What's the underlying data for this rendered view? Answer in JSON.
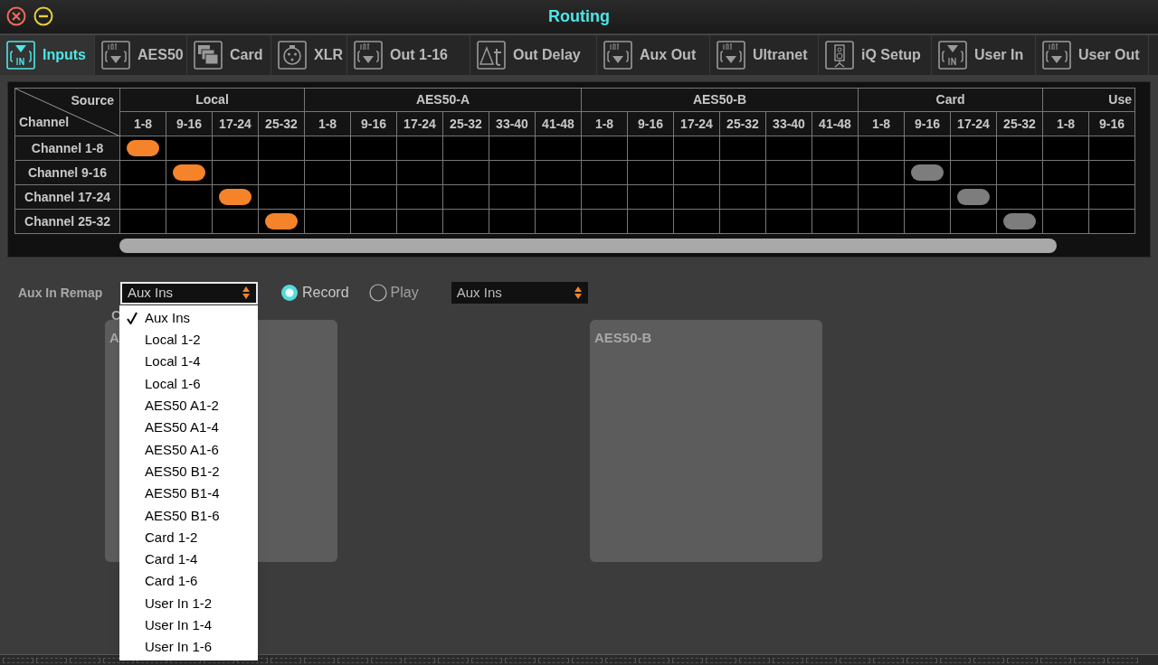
{
  "window": {
    "title": "Routing"
  },
  "tabs": [
    {
      "label": "Inputs",
      "selected": true
    },
    {
      "label": "AES50",
      "selected": false
    },
    {
      "label": "Card",
      "selected": false
    },
    {
      "label": "XLR",
      "selected": false
    },
    {
      "label": "Out 1-16",
      "selected": false
    },
    {
      "label": "Out Delay",
      "selected": false
    },
    {
      "label": "Aux Out",
      "selected": false
    },
    {
      "label": "Ultranet",
      "selected": false
    },
    {
      "label": "iQ Setup",
      "selected": false
    },
    {
      "label": "User In",
      "selected": false
    },
    {
      "label": "User Out",
      "selected": false
    }
  ],
  "grid": {
    "source_label": "Source",
    "channel_label": "Channel",
    "groups": [
      {
        "label": "Local",
        "columns": [
          "1-8",
          "9-16",
          "17-24",
          "25-32"
        ]
      },
      {
        "label": "AES50-A",
        "columns": [
          "1-8",
          "9-16",
          "17-24",
          "25-32",
          "33-40",
          "41-48"
        ]
      },
      {
        "label": "AES50-B",
        "columns": [
          "1-8",
          "9-16",
          "17-24",
          "25-32",
          "33-40",
          "41-48"
        ]
      },
      {
        "label": "Card",
        "columns": [
          "1-8",
          "9-16",
          "17-24",
          "25-32"
        ]
      },
      {
        "label": "Use",
        "columns": [
          "1-8",
          "9-16"
        ]
      }
    ],
    "rows": [
      {
        "label": "Channel 1-8",
        "cells": [
          {
            "kind": "active"
          },
          {
            "kind": "empty"
          },
          {
            "kind": "empty"
          },
          {
            "kind": "empty"
          },
          {
            "kind": "empty"
          },
          {
            "kind": "empty"
          },
          {
            "kind": "empty"
          },
          {
            "kind": "empty"
          },
          {
            "kind": "empty"
          },
          {
            "kind": "empty"
          },
          {
            "kind": "empty"
          },
          {
            "kind": "empty"
          },
          {
            "kind": "empty"
          },
          {
            "kind": "empty"
          },
          {
            "kind": "empty"
          },
          {
            "kind": "empty"
          },
          {
            "kind": "empty"
          },
          {
            "kind": "empty"
          },
          {
            "kind": "empty"
          },
          {
            "kind": "empty"
          },
          {
            "kind": "empty"
          },
          {
            "kind": "empty"
          }
        ]
      },
      {
        "label": "Channel 9-16",
        "cells": [
          {
            "kind": "empty"
          },
          {
            "kind": "active"
          },
          {
            "kind": "empty"
          },
          {
            "kind": "empty"
          },
          {
            "kind": "empty"
          },
          {
            "kind": "empty"
          },
          {
            "kind": "empty"
          },
          {
            "kind": "empty"
          },
          {
            "kind": "empty"
          },
          {
            "kind": "empty"
          },
          {
            "kind": "empty"
          },
          {
            "kind": "empty"
          },
          {
            "kind": "empty"
          },
          {
            "kind": "empty"
          },
          {
            "kind": "empty"
          },
          {
            "kind": "empty"
          },
          {
            "kind": "empty"
          },
          {
            "kind": "inactive"
          },
          {
            "kind": "empty"
          },
          {
            "kind": "empty"
          },
          {
            "kind": "empty"
          },
          {
            "kind": "empty"
          }
        ]
      },
      {
        "label": "Channel 17-24",
        "cells": [
          {
            "kind": "empty"
          },
          {
            "kind": "empty"
          },
          {
            "kind": "active"
          },
          {
            "kind": "empty"
          },
          {
            "kind": "empty"
          },
          {
            "kind": "empty"
          },
          {
            "kind": "empty"
          },
          {
            "kind": "empty"
          },
          {
            "kind": "empty"
          },
          {
            "kind": "empty"
          },
          {
            "kind": "empty"
          },
          {
            "kind": "empty"
          },
          {
            "kind": "empty"
          },
          {
            "kind": "empty"
          },
          {
            "kind": "empty"
          },
          {
            "kind": "empty"
          },
          {
            "kind": "empty"
          },
          {
            "kind": "empty"
          },
          {
            "kind": "inactive"
          },
          {
            "kind": "empty"
          },
          {
            "kind": "empty"
          },
          {
            "kind": "empty"
          }
        ]
      },
      {
        "label": "Channel 25-32",
        "cells": [
          {
            "kind": "empty"
          },
          {
            "kind": "empty"
          },
          {
            "kind": "empty"
          },
          {
            "kind": "active"
          },
          {
            "kind": "empty"
          },
          {
            "kind": "empty"
          },
          {
            "kind": "empty"
          },
          {
            "kind": "empty"
          },
          {
            "kind": "empty"
          },
          {
            "kind": "empty"
          },
          {
            "kind": "empty"
          },
          {
            "kind": "empty"
          },
          {
            "kind": "empty"
          },
          {
            "kind": "empty"
          },
          {
            "kind": "empty"
          },
          {
            "kind": "empty"
          },
          {
            "kind": "empty"
          },
          {
            "kind": "empty"
          },
          {
            "kind": "empty"
          },
          {
            "kind": "inactive"
          },
          {
            "kind": "empty"
          },
          {
            "kind": "empty"
          }
        ]
      }
    ]
  },
  "remap": {
    "label": "Aux In Remap",
    "select": {
      "value": "Aux Ins",
      "open": true
    },
    "options": [
      {
        "label": "Aux Ins",
        "selected": true
      },
      {
        "label": "Local 1-2",
        "selected": false
      },
      {
        "label": "Local 1-4",
        "selected": false
      },
      {
        "label": "Local 1-6",
        "selected": false
      },
      {
        "label": "AES50 A1-2",
        "selected": false
      },
      {
        "label": "AES50 A1-4",
        "selected": false
      },
      {
        "label": "AES50 A1-6",
        "selected": false
      },
      {
        "label": "AES50 B1-2",
        "selected": false
      },
      {
        "label": "AES50 B1-4",
        "selected": false
      },
      {
        "label": "AES50 B1-6",
        "selected": false
      },
      {
        "label": "Card 1-2",
        "selected": false
      },
      {
        "label": "Card 1-4",
        "selected": false
      },
      {
        "label": "Card 1-6",
        "selected": false
      },
      {
        "label": "User In 1-2",
        "selected": false
      },
      {
        "label": "User In 1-4",
        "selected": false
      },
      {
        "label": "User In 1-6",
        "selected": false
      }
    ],
    "modes": [
      {
        "label": "Record",
        "selected": true
      },
      {
        "label": "Play",
        "selected": false
      }
    ],
    "second_select": {
      "value": "Aux Ins"
    }
  },
  "section_label": "C",
  "panels": [
    {
      "title": "A"
    },
    {
      "title": "AES50-B"
    }
  ]
}
